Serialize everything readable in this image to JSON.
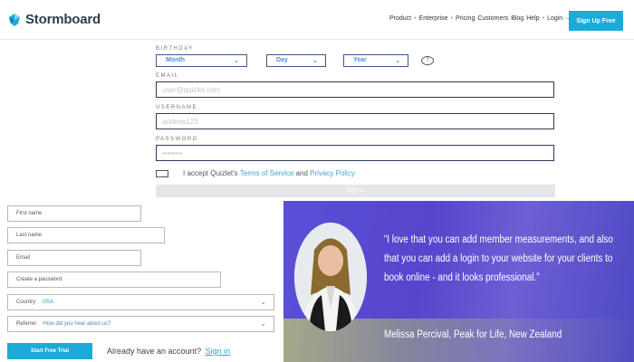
{
  "header": {
    "logo_text": "Stormboard",
    "nav": [
      "Product",
      "Enterprise",
      "Pricing",
      "Customers",
      "Blog",
      "Help",
      "Login →"
    ],
    "signup_label": "Sign Up Free"
  },
  "quizlet_form": {
    "birthday_label": "BIRTHDAY",
    "month_label": "Month",
    "day_label": "Day",
    "year_label": "Year",
    "help_glyph": "?",
    "email_label": "EMAIL",
    "email_placeholder": "user@quizlet.com",
    "username_label": "USERNAME",
    "username_placeholder": "andrew123",
    "password_label": "PASSWORD",
    "password_placeholder": "••••••••",
    "terms_prefix": "I accept Quizlet's",
    "terms_link": "Terms of Service",
    "terms_and": "and",
    "privacy_link": "Privacy Policy",
    "submit_label": "Sign up"
  },
  "storm_form": {
    "first_name": "First name",
    "last_name": "Last name",
    "email": "Email",
    "password": "Create a password",
    "country_label": "Country:",
    "country_value": "USA",
    "referrer_label": "Referrer:",
    "referrer_value": "How did you hear about us?",
    "start_label": "Start Free Trial",
    "have_account": "Already have an account?",
    "sign_in": "Sign in"
  },
  "testimonial": {
    "quote": "“I love that you can add member measurements, and also that you can add a login to your website for your clients to book online - and it looks professional.”",
    "attribution": "Melissa Percival, Peak for Life, New Zealand"
  },
  "colors": {
    "accent": "#1cabd9",
    "testimonial_bg": "#5646cc"
  }
}
